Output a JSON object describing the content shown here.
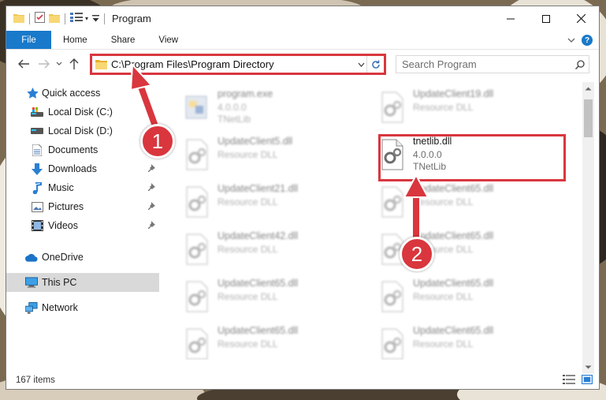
{
  "window": {
    "title": "Program",
    "ribbon_tabs": [
      "File",
      "Home",
      "Share",
      "View"
    ],
    "help_label": "?"
  },
  "address": {
    "path": "C:\\Program Files\\Program Directory",
    "search_placeholder": "Search Program"
  },
  "nav": {
    "items": [
      {
        "label": "Quick access",
        "icon": "star-icon"
      },
      {
        "label": "Local Disk (C:)",
        "icon": "drive-icon"
      },
      {
        "label": "Local Disk (D:)",
        "icon": "drive-icon"
      },
      {
        "label": "Documents",
        "icon": "documents-icon"
      },
      {
        "label": "Downloads",
        "icon": "download-icon"
      },
      {
        "label": "Music",
        "icon": "music-icon"
      },
      {
        "label": "Pictures",
        "icon": "pictures-icon"
      },
      {
        "label": "Videos",
        "icon": "videos-icon"
      },
      {
        "label": "OneDrive",
        "icon": "cloud-icon"
      },
      {
        "label": "This PC",
        "icon": "computer-icon"
      },
      {
        "label": "Network",
        "icon": "network-icon"
      }
    ]
  },
  "files": [
    {
      "name": "program.exe",
      "line1": "4.0.0.0",
      "line2": "TNetLib",
      "icon": "exe-icon"
    },
    {
      "name": "UpdateClient19.dll",
      "line1": "Resource DLL",
      "line2": "",
      "icon": "dll-icon"
    },
    {
      "name": "UpdateClient5.dll",
      "line1": "Resource DLL",
      "line2": "",
      "icon": "dll-icon"
    },
    {
      "name": "tnetlib.dll",
      "line1": "4.0.0.0",
      "line2": "TNetLib",
      "icon": "dll-icon"
    },
    {
      "name": "UpdateClient21.dll",
      "line1": "Resource DLL",
      "line2": "",
      "icon": "dll-icon"
    },
    {
      "name": "UpdateClient65.dll",
      "line1": "Resource DLL",
      "line2": "",
      "icon": "dll-icon"
    },
    {
      "name": "UpdateClient42.dll",
      "line1": "Resource DLL",
      "line2": "",
      "icon": "dll-icon"
    },
    {
      "name": "UpdateClient65.dll",
      "line1": "Resource DLL",
      "line2": "",
      "icon": "dll-icon"
    },
    {
      "name": "UpdateClient65.dll",
      "line1": "Resource DLL",
      "line2": "",
      "icon": "dll-icon"
    },
    {
      "name": "UpdateClient65.dll",
      "line1": "Resource DLL",
      "line2": "",
      "icon": "dll-icon"
    },
    {
      "name": "UpdateClient65.dll",
      "line1": "Resource DLL",
      "line2": "",
      "icon": "dll-icon"
    },
    {
      "name": "UpdateClient65.dll",
      "line1": "Resource DLL",
      "line2": "",
      "icon": "dll-icon"
    }
  ],
  "status": {
    "count": "167 items"
  },
  "callouts": [
    "1",
    "2"
  ],
  "colors": {
    "accent": "#1979ca",
    "callout": "#d9363e",
    "selected": "#d9d9d9"
  }
}
